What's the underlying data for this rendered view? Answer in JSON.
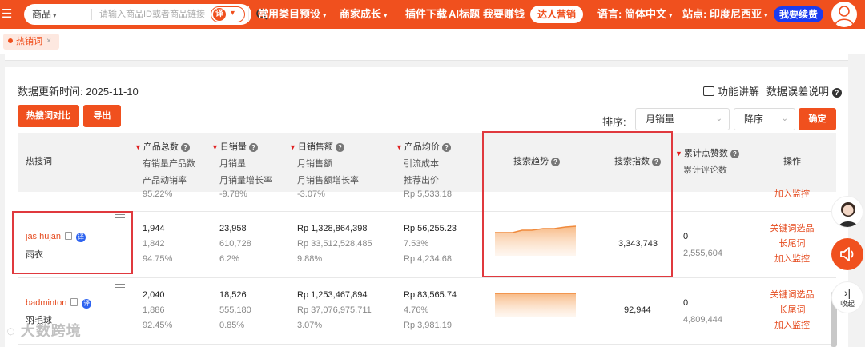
{
  "topbar": {
    "search_type": "商品",
    "search_placeholder": "请输入商品ID或者商品链接",
    "translate_icon_text": "译",
    "menu": [
      "常用类目预设",
      "商家成长",
      "插件下载",
      "AI标题",
      "我要赚钱"
    ],
    "daren": "达人营销",
    "language": "语言: 简体中文",
    "site": "站点: 印度尼西亚",
    "renew": "我要续费"
  },
  "tab": {
    "label": "热销词",
    "close": "×"
  },
  "toolbar": {
    "update_time": "数据更新时间:  2025-11-10",
    "func_explain": "功能讲解",
    "data_error": "数据误差说明",
    "compare_btn": "热搜词对比",
    "export_btn": "导出",
    "sort_label": "排序:",
    "sort_field": "月销量",
    "sort_order": "降序",
    "confirm_btn": "确定"
  },
  "table": {
    "headers": {
      "keyword": "热搜词",
      "products": [
        "产品总数",
        "有销量产品数",
        "产品动销率"
      ],
      "sales": [
        "日销量",
        "月销量",
        "月销量增长率"
      ],
      "revenue": [
        "日销售额",
        "月销售额",
        "月销售额增长率"
      ],
      "price": [
        "产品均价",
        "引流成本",
        "推荐出价"
      ],
      "trend": "搜索趋势",
      "index": "搜索指数",
      "likes": [
        "累计点赞数",
        "累计评论数"
      ],
      "ops": "操作"
    },
    "partial_row": {
      "products": "95.22%",
      "sales": "-9.78%",
      "revenue": "-3.07%",
      "price": "Rp 5,533.18",
      "op": "加入监控"
    },
    "rows": [
      {
        "keyword": "jas hujan",
        "keyword_cn": "雨衣",
        "products": [
          "1,944",
          "1,842",
          "94.75%"
        ],
        "sales": [
          "23,958",
          "610,728",
          "6.2%"
        ],
        "revenue": [
          "Rp 1,328,864,398",
          "Rp 33,512,528,485",
          "9.88%"
        ],
        "price": [
          "Rp 56,255.23",
          "7.53%",
          "Rp 4,234.68"
        ],
        "index": "3,343,743",
        "likes": [
          "0",
          "2,555,604"
        ],
        "ops": [
          "关键词选品",
          "长尾词",
          "加入监控"
        ]
      },
      {
        "keyword": "badminton",
        "keyword_cn": "羽毛球",
        "products": [
          "2,040",
          "1,886",
          "92.45%"
        ],
        "sales": [
          "18,526",
          "555,180",
          "0.85%"
        ],
        "revenue": [
          "Rp 1,253,467,894",
          "Rp 37,076,975,711",
          "3.07%"
        ],
        "price": [
          "Rp 83,565.74",
          "4.76%",
          "Rp 3,981.19"
        ],
        "index": "92,944",
        "likes": [
          "0",
          "4,809,444"
        ],
        "ops": [
          "关键词选品",
          "长尾词",
          "加入监控"
        ]
      }
    ]
  },
  "side": {
    "collapse": "收起"
  },
  "watermark": "大数跨境",
  "colors": {
    "brand": "#f0501e",
    "highlight_box": "#e0393e",
    "renew": "#1a3cf0",
    "trend": "#f5a35c"
  }
}
